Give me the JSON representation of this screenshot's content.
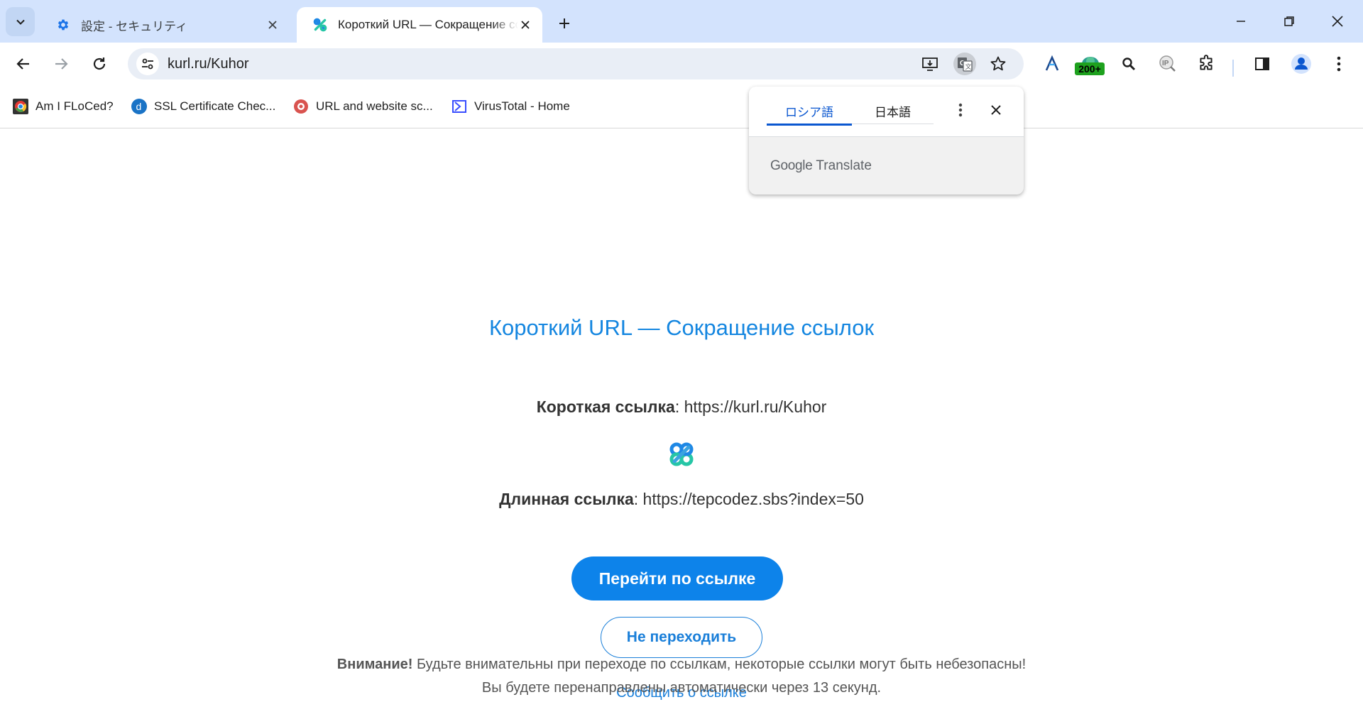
{
  "tabs": [
    {
      "title": "設定 - セキュリティ"
    },
    {
      "title": "Короткий URL — Сокращение ссылок"
    }
  ],
  "address_bar": {
    "url": "kurl.ru/Kuhor"
  },
  "extensions": {
    "badge": "200+"
  },
  "bookmarks": [
    {
      "label": "Am I FLoCed?"
    },
    {
      "label": "SSL Certificate Chec..."
    },
    {
      "label": "URL and website sc..."
    },
    {
      "label": "VirusTotal - Home"
    }
  ],
  "translate_popup": {
    "tab_source": "ロシア語",
    "tab_target": "日本語",
    "brand_google": "Google",
    "brand_translate": "Translate"
  },
  "page": {
    "title": "Короткий URL — Сокращение ссылок",
    "short_label": "Короткая ссылка",
    "short_value": "https://kurl.ru/Kuhor",
    "long_label": "Длинная ссылка",
    "long_value": "https://tepcodez.sbs?index=50",
    "go_button": "Перейти по ссылке",
    "stay_button": "Не переходить",
    "warning_bold": "Внимание!",
    "warning_text": "Будьте внимательны при переходе по ссылкам, некоторые ссылки могут быть небезопасны!",
    "redirect_text": "Вы будете перенаправлены автоматически через 13 секунд.",
    "report_link": "Сообщить о ссылке"
  },
  "colors": {
    "accent": "#0d83ea",
    "title": "#1486e0",
    "tabstrip": "#d3e3fd"
  }
}
